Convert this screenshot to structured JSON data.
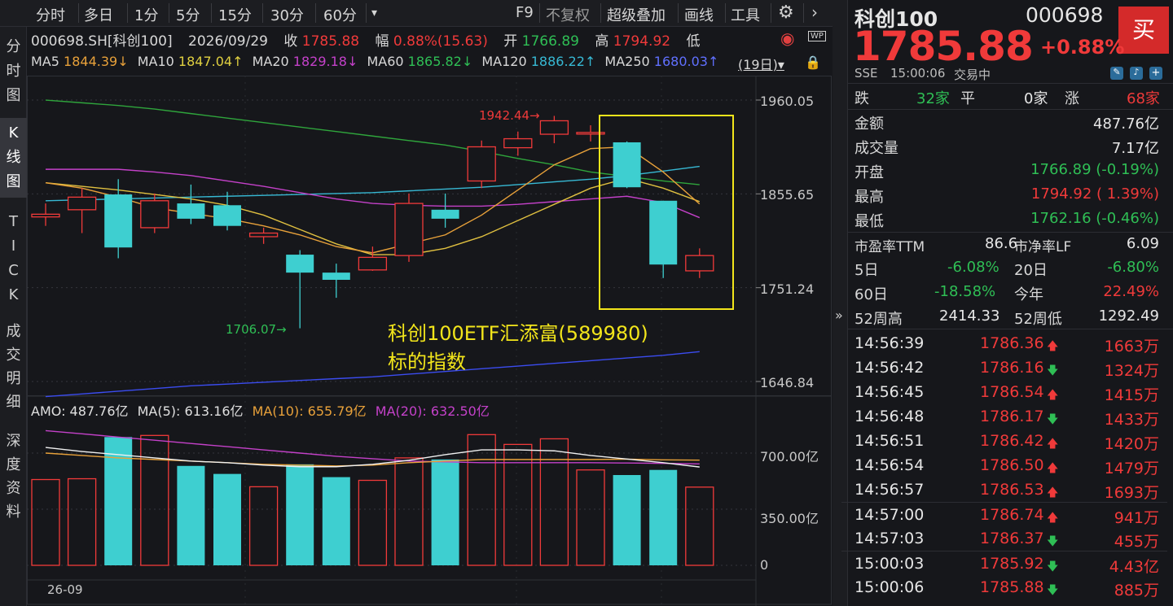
{
  "toolbar": {
    "items": [
      "分时",
      "多日",
      "1分",
      "5分",
      "15分",
      "30分",
      "60分",
      "▾",
      "F9",
      "不复权",
      "超级叠加",
      "画线",
      "工具"
    ],
    "gear_icon": "gear-icon",
    "next_icon": "chevron-right-icon"
  },
  "left_tabs": [
    "分时图",
    "K线图",
    "TICK",
    "成交明细",
    "深度资料"
  ],
  "info": {
    "code": "000698.SH[科创100]",
    "date": "2026/09/29",
    "close_label": "收",
    "close": "1785.88",
    "change_label": "幅",
    "change": "0.88%(15.63)",
    "open_label": "开",
    "open": "1766.89",
    "high_label": "高",
    "high": "1794.92",
    "low_label": "低"
  },
  "ma": {
    "ma5_label": "MA5",
    "ma5": "1844.39↓",
    "ma10_label": "MA10",
    "ma10": "1847.04↑",
    "ma20_label": "MA20",
    "ma20": "1829.18↓",
    "ma60_label": "MA60",
    "ma60": "1865.82↓",
    "ma120_label": "MA120",
    "ma120": "1886.22↑",
    "ma250_label": "MA250",
    "ma250": "1680.03↑",
    "period": "(19日)▾"
  },
  "amo": {
    "label": "AMO: 487.76亿",
    "ma5": "MA(5): 613.16亿",
    "ma10": "MA(10): 655.79亿",
    "ma20": "MA(20): 632.50亿"
  },
  "annotation": {
    "line1": "科创100ETF汇添富(589980)",
    "line2": "标的指数"
  },
  "x_label": "26-09",
  "chart_data": {
    "type": "candlestick",
    "ylim": [
      1630,
      1975
    ],
    "y_ticks": [
      1960.05,
      1855.65,
      1751.24,
      1646.84
    ],
    "y_tick_labels": [
      "1960.05",
      "1855.65",
      "1751.24",
      "1646.84"
    ],
    "high_mark": "1942.44",
    "low_mark": "1706.07",
    "candles": [
      {
        "o": 1830,
        "c": 1833,
        "h": 1845,
        "l": 1820
      },
      {
        "o": 1838,
        "c": 1852,
        "h": 1862,
        "l": 1812
      },
      {
        "o": 1855,
        "c": 1796,
        "h": 1872,
        "l": 1784
      },
      {
        "o": 1818,
        "c": 1848,
        "h": 1856,
        "l": 1812
      },
      {
        "o": 1845,
        "c": 1828,
        "h": 1866,
        "l": 1822
      },
      {
        "o": 1843,
        "c": 1820,
        "h": 1858,
        "l": 1815
      },
      {
        "o": 1808,
        "c": 1812,
        "h": 1818,
        "l": 1800
      },
      {
        "o": 1788,
        "c": 1768,
        "h": 1793,
        "l": 1706.07
      },
      {
        "o": 1768,
        "c": 1760,
        "h": 1778,
        "l": 1740
      },
      {
        "o": 1771,
        "c": 1785,
        "h": 1797,
        "l": 1770
      },
      {
        "o": 1787,
        "c": 1845,
        "h": 1856,
        "l": 1780
      },
      {
        "o": 1838,
        "c": 1828,
        "h": 1856,
        "l": 1818
      },
      {
        "o": 1870,
        "c": 1908,
        "h": 1915,
        "l": 1862
      },
      {
        "o": 1907,
        "c": 1917,
        "h": 1925,
        "l": 1898
      },
      {
        "o": 1922,
        "c": 1937,
        "h": 1942.44,
        "l": 1912
      },
      {
        "o": 1923,
        "c": 1924,
        "h": 1932,
        "l": 1914
      },
      {
        "o": 1913,
        "c": 1863,
        "h": 1914,
        "l": 1862
      },
      {
        "o": 1848,
        "c": 1777,
        "h": 1848,
        "l": 1762
      },
      {
        "o": 1770,
        "c": 1787,
        "h": 1795,
        "l": 1762
      }
    ],
    "ma5": [
      1868,
      1862,
      1852,
      1840,
      1834,
      1828,
      1820,
      1810,
      1797,
      1790,
      1800,
      1810,
      1832,
      1860,
      1888,
      1906,
      1908,
      1880,
      1844.39
    ],
    "ma10": [
      1868,
      1864,
      1860,
      1855,
      1850,
      1843,
      1832,
      1816,
      1800,
      1788,
      1788,
      1795,
      1808,
      1826,
      1844,
      1862,
      1873,
      1862,
      1847.04
    ],
    "ma20": [
      1883,
      1883,
      1883,
      1880,
      1876,
      1870,
      1864,
      1857,
      1850,
      1845,
      1843,
      1842,
      1842,
      1844,
      1847,
      1850,
      1853,
      1846,
      1829.18
    ],
    "ma60": [
      1960,
      1957,
      1954,
      1950,
      1945,
      1940,
      1935,
      1930,
      1925,
      1920,
      1915,
      1910,
      1903,
      1895,
      1888,
      1880,
      1875,
      1870,
      1865.82
    ],
    "ma120": [
      1848,
      1849,
      1850,
      1851,
      1852,
      1853,
      1854,
      1855,
      1856,
      1857,
      1859,
      1861,
      1863,
      1866,
      1869,
      1872,
      1876,
      1881,
      1886.22
    ],
    "ma250": [
      1630,
      1633,
      1636,
      1639,
      1642,
      1644,
      1646,
      1648,
      1650,
      1652,
      1655,
      1658,
      1661,
      1664,
      1667,
      1670,
      1673,
      1676,
      1680.03
    ],
    "volume_ylim": [
      0,
      960
    ],
    "volume_ticks": [
      700,
      350,
      0
    ],
    "volume_tick_labels": [
      "700.00亿",
      "350.00亿",
      "0"
    ],
    "volume": [
      535,
      540,
      800,
      810,
      620,
      570,
      490,
      630,
      550,
      530,
      670,
      660,
      815,
      754,
      789,
      595,
      563,
      595,
      487.76
    ],
    "vol_ma5": [
      735,
      710,
      690,
      670,
      650,
      640,
      625,
      615,
      615,
      630,
      655,
      690,
      720,
      720,
      714,
      685,
      663,
      640,
      613.16
    ],
    "vol_ma10": [
      700,
      685,
      670,
      660,
      650,
      640,
      630,
      625,
      620,
      625,
      640,
      650,
      660,
      660,
      660,
      660,
      662,
      658,
      655.79
    ],
    "vol_ma20": [
      840,
      820,
      800,
      780,
      760,
      740,
      720,
      700,
      680,
      665,
      650,
      645,
      640,
      640,
      640,
      640,
      638,
      636,
      632.5
    ]
  },
  "right": {
    "name": "科创100",
    "code": "000698",
    "buy_label": "买",
    "price": "1785.88",
    "pct": "+0.88%",
    "exchange": "SSE",
    "time": "15:00:06",
    "status": "交易中",
    "breadth": {
      "down_label": "跌",
      "down": "32家",
      "flat_label": "平",
      "flat": "0家",
      "up_label": "涨",
      "up": "68家"
    },
    "stats": [
      {
        "label": "金额",
        "value": "487.76亿",
        "tone": "white"
      },
      {
        "label": "成交量",
        "value": "7.17亿",
        "tone": "white"
      },
      {
        "label": "开盘",
        "value": "1766.89 (-0.19%)",
        "tone": "green"
      },
      {
        "label": "最高",
        "value": "1794.92 ( 1.39%)",
        "tone": "red"
      },
      {
        "label": "最低",
        "value": "1762.16 (-0.46%)",
        "tone": "green"
      }
    ],
    "pe_label": "市盈率TTM",
    "pe": "86.6",
    "pb_label": "市净率LF",
    "pb": "6.09",
    "d5_label": "5日",
    "d5": "-6.08%",
    "d20_label": "20日",
    "d20": "-6.80%",
    "d60_label": "60日",
    "d60": "-18.58%",
    "ytd_label": "今年",
    "ytd": "22.49%",
    "w52h_label": "52周高",
    "w52h": "2414.33",
    "w52l_label": "52周低",
    "w52l": "1292.49",
    "ticks": [
      {
        "time": "14:56:39",
        "price": "1786.36",
        "dir": "up",
        "vol": "1663万"
      },
      {
        "time": "14:56:42",
        "price": "1786.16",
        "dir": "down",
        "vol": "1324万"
      },
      {
        "time": "14:56:45",
        "price": "1786.54",
        "dir": "up",
        "vol": "1415万"
      },
      {
        "time": "14:56:48",
        "price": "1786.17",
        "dir": "down",
        "vol": "1433万"
      },
      {
        "time": "14:56:51",
        "price": "1786.42",
        "dir": "up",
        "vol": "1420万"
      },
      {
        "time": "14:56:54",
        "price": "1786.50",
        "dir": "up",
        "vol": "1479万"
      },
      {
        "time": "14:56:57",
        "price": "1786.53",
        "dir": "up",
        "vol": "1693万"
      },
      {
        "time": "14:57:00",
        "price": "1786.74",
        "dir": "up",
        "vol": "941万"
      },
      {
        "time": "14:57:03",
        "price": "1786.37",
        "dir": "down",
        "vol": "455万"
      },
      {
        "time": "15:00:03",
        "price": "1785.92",
        "dir": "down",
        "vol": "4.43亿"
      },
      {
        "time": "15:00:06",
        "price": "1785.88",
        "dir": "down",
        "vol": "885万"
      }
    ]
  },
  "colors": {
    "up": "#f03a3a",
    "down": "#3ecfd0",
    "ma5": "#ffffff",
    "ma10": "#e8a13a",
    "ma20": "#c441c9",
    "ma60": "#2fa53c",
    "ma120": "#37b9d4",
    "ma250": "#3b4cf0",
    "highlight": "#f2e51b"
  }
}
